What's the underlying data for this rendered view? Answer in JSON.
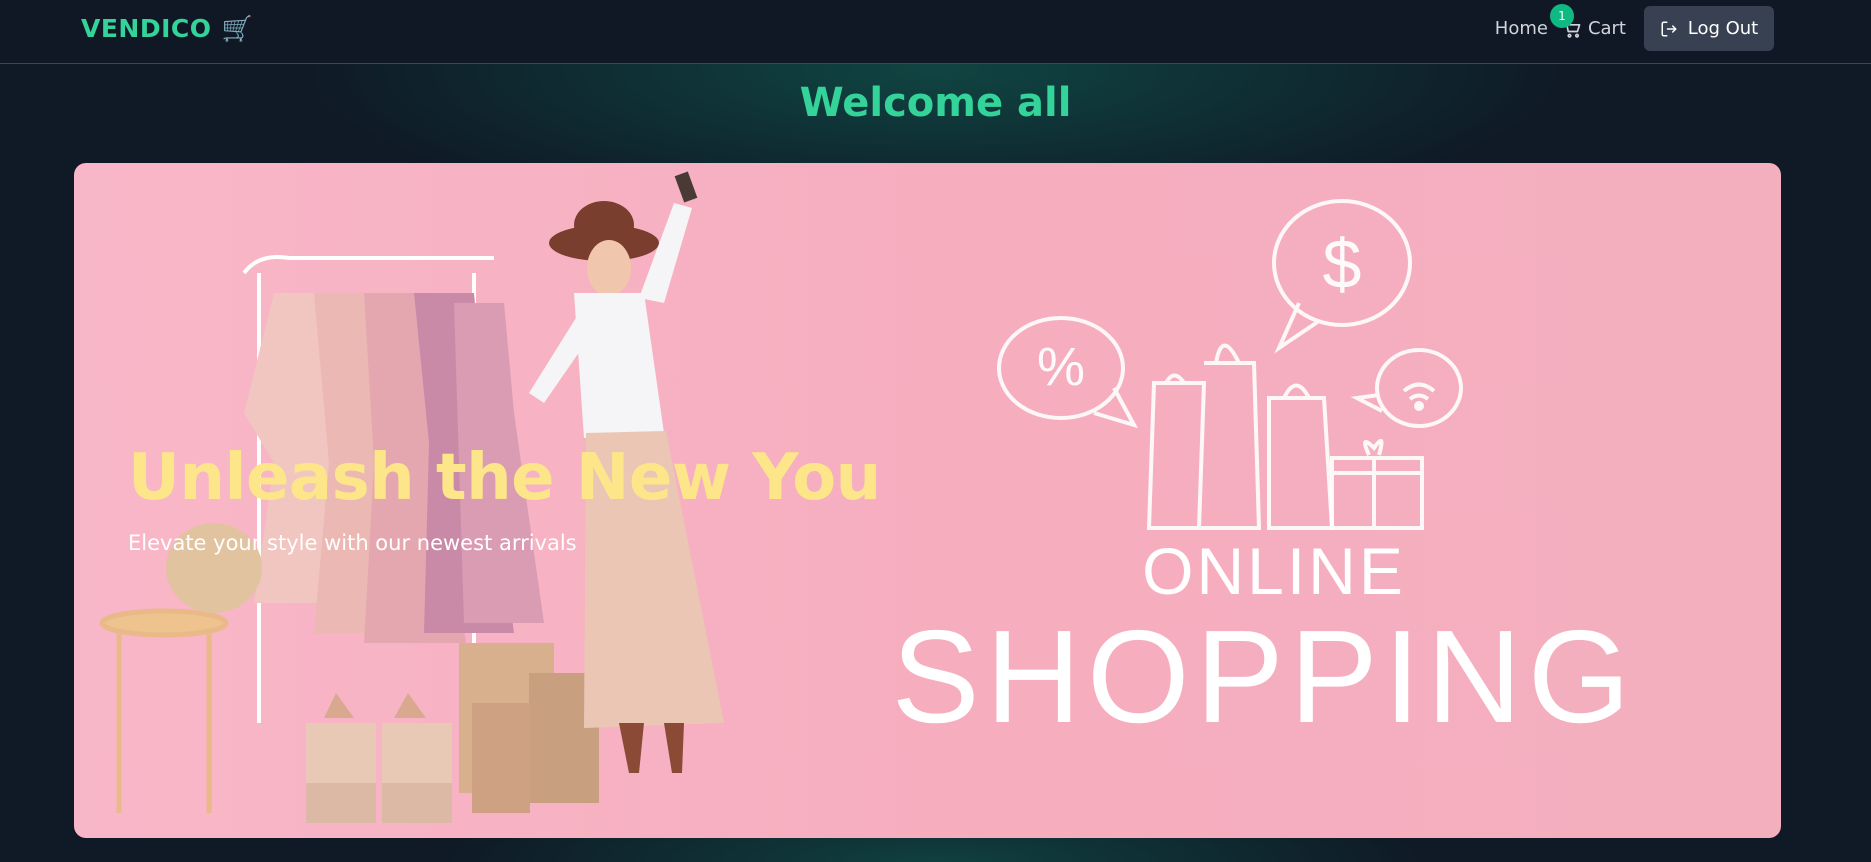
{
  "navbar": {
    "brand": "VENDICO",
    "brand_icon": "shopping-cart-icon",
    "home_label": "Home",
    "cart_label": "Cart",
    "cart_count": "1",
    "logout_label": "Log Out"
  },
  "welcome": "Welcome all",
  "hero": {
    "title": "Unleash the New You",
    "subtitle": "Elevate your style with our newest arrivals",
    "image_text_line1": "ONLINE",
    "image_text_line2": "SHOPPING",
    "icons": [
      "percent-bubble-icon",
      "dollar-bubble-icon",
      "wifi-bubble-icon",
      "shopping-bags-icon",
      "gift-box-icon"
    ]
  },
  "colors": {
    "accent": "#34d399",
    "badge": "#10b981",
    "nav_bg": "#101826",
    "hero_bg": "#f6aebf",
    "hero_title": "#fde68a"
  }
}
